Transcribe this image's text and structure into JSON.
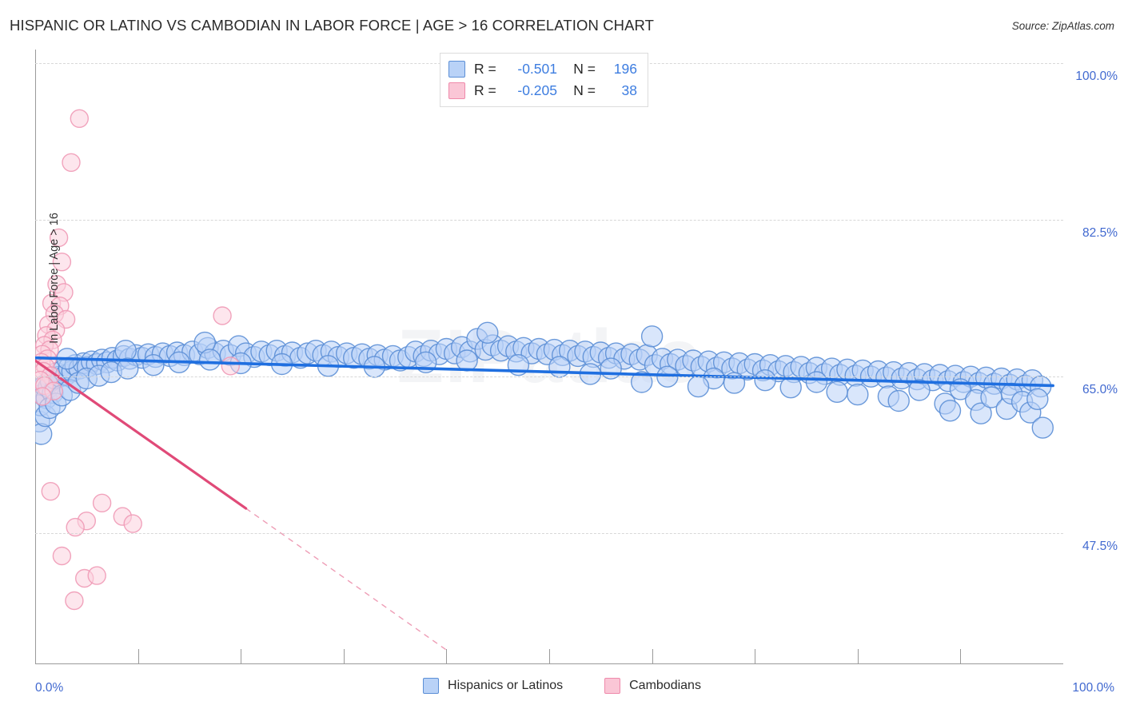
{
  "header": {
    "title": "HISPANIC OR LATINO VS CAMBODIAN IN LABOR FORCE | AGE > 16 CORRELATION CHART",
    "source": "Source: ZipAtlas.com"
  },
  "watermark": "ZIPatlas",
  "stat_legend": {
    "rows": [
      {
        "color": "#b9d2f7",
        "r_label": "R =",
        "r_value": "-0.501",
        "n_label": "N =",
        "n_value": "196"
      },
      {
        "color": "#fac6d6",
        "r_label": "R =",
        "r_value": "-0.205",
        "n_label": "N =",
        "n_value": "38"
      }
    ]
  },
  "series_legend": [
    {
      "label": "Hispanics or Latinos",
      "color": "#b9d2f7"
    },
    {
      "label": "Cambodians",
      "color": "#fac6d6"
    }
  ],
  "axes": {
    "y_title": "In Labor Force | Age > 16",
    "y_ticks": [
      "100.0%",
      "82.5%",
      "65.0%",
      "47.5%"
    ],
    "x_ticks": [
      "0.0%",
      "100.0%"
    ],
    "x_min": 0,
    "x_max": 100,
    "y_min": 33.0,
    "y_max": 101.5
  },
  "colors": {
    "blue_fill": "#b9d2f7",
    "blue_stroke": "#5c8fd6",
    "blue_line": "#1f6fe0",
    "pink_fill": "#fbd2de",
    "pink_stroke": "#f09ab6",
    "pink_line": "#e04a78",
    "tick_text": "#4169d0",
    "grid": "#d8d8d8"
  },
  "chart_data": {
    "type": "scatter",
    "title": "HISPANIC OR LATINO VS CAMBODIAN IN LABOR FORCE | AGE > 16 CORRELATION CHART",
    "xlabel": "",
    "ylabel": "In Labor Force | Age > 16",
    "xlim": [
      0,
      100
    ],
    "ylim": [
      33.0,
      101.5
    ],
    "x_tick_labels": [
      "0.0%",
      "100.0%"
    ],
    "y_tick_values": [
      100.0,
      82.5,
      65.0,
      47.5
    ],
    "y_tick_labels": [
      "100.0%",
      "82.5%",
      "65.0%",
      "47.5%"
    ],
    "grid": true,
    "legend_position": "bottom-center",
    "series": [
      {
        "name": "Hispanics or Latinos",
        "color": "#b9d2f7",
        "R": -0.501,
        "N": 196,
        "trendline": {
          "style": "solid",
          "color": "#1f6fe0",
          "x0": 0.0,
          "y0": 67.1,
          "x1": 99.0,
          "y1": 64.0
        },
        "points": [
          [
            0.4,
            60.0
          ],
          [
            0.5,
            61.8
          ],
          [
            0.7,
            63.0
          ],
          [
            0.9,
            64.0
          ],
          [
            1.1,
            62.6
          ],
          [
            1.3,
            63.8
          ],
          [
            1.5,
            64.5
          ],
          [
            1.7,
            63.2
          ],
          [
            1.9,
            64.8
          ],
          [
            2.1,
            65.4
          ],
          [
            2.4,
            65.0
          ],
          [
            2.7,
            65.7
          ],
          [
            3.0,
            65.2
          ],
          [
            3.3,
            66.0
          ],
          [
            3.6,
            65.6
          ],
          [
            3.9,
            66.3
          ],
          [
            4.3,
            65.9
          ],
          [
            4.7,
            66.5
          ],
          [
            5.1,
            66.1
          ],
          [
            5.5,
            66.7
          ],
          [
            6.0,
            66.4
          ],
          [
            6.5,
            66.9
          ],
          [
            7.0,
            66.6
          ],
          [
            7.5,
            67.1
          ],
          [
            8.0,
            66.8
          ],
          [
            8.6,
            67.3
          ],
          [
            9.2,
            67.0
          ],
          [
            9.8,
            67.4
          ],
          [
            10.4,
            67.1
          ],
          [
            11.0,
            67.5
          ],
          [
            11.7,
            67.2
          ],
          [
            12.4,
            67.6
          ],
          [
            13.1,
            67.3
          ],
          [
            13.8,
            67.7
          ],
          [
            14.5,
            67.4
          ],
          [
            15.3,
            67.8
          ],
          [
            16.0,
            67.5
          ],
          [
            16.8,
            68.2
          ],
          [
            17.5,
            67.6
          ],
          [
            18.3,
            67.9
          ],
          [
            19.0,
            67.4
          ],
          [
            19.8,
            68.4
          ],
          [
            20.5,
            67.6
          ],
          [
            21.3,
            67.2
          ],
          [
            22.0,
            67.8
          ],
          [
            22.8,
            67.4
          ],
          [
            23.5,
            67.9
          ],
          [
            24.3,
            67.3
          ],
          [
            25.0,
            67.7
          ],
          [
            25.8,
            67.1
          ],
          [
            26.5,
            67.6
          ],
          [
            27.3,
            67.9
          ],
          [
            28.0,
            67.4
          ],
          [
            28.8,
            67.8
          ],
          [
            29.5,
            67.2
          ],
          [
            30.3,
            67.6
          ],
          [
            31.0,
            67.1
          ],
          [
            31.8,
            67.5
          ],
          [
            32.5,
            67.0
          ],
          [
            33.3,
            67.4
          ],
          [
            34.0,
            66.9
          ],
          [
            34.8,
            67.3
          ],
          [
            35.5,
            66.8
          ],
          [
            36.3,
            67.2
          ],
          [
            37.0,
            67.8
          ],
          [
            37.8,
            67.3
          ],
          [
            38.5,
            67.9
          ],
          [
            39.3,
            67.5
          ],
          [
            40.0,
            68.1
          ],
          [
            40.8,
            67.6
          ],
          [
            41.5,
            68.3
          ],
          [
            42.3,
            67.8
          ],
          [
            43.0,
            69.2
          ],
          [
            43.8,
            68.0
          ],
          [
            44.5,
            68.5
          ],
          [
            45.3,
            67.9
          ],
          [
            46.0,
            68.4
          ],
          [
            46.8,
            67.8
          ],
          [
            47.5,
            68.2
          ],
          [
            48.3,
            67.6
          ],
          [
            49.0,
            68.1
          ],
          [
            49.8,
            67.5
          ],
          [
            50.5,
            68.0
          ],
          [
            51.3,
            67.4
          ],
          [
            52.0,
            67.9
          ],
          [
            52.8,
            67.3
          ],
          [
            53.5,
            67.8
          ],
          [
            54.3,
            67.2
          ],
          [
            55.0,
            67.7
          ],
          [
            55.8,
            67.1
          ],
          [
            56.5,
            67.6
          ],
          [
            57.3,
            67.0
          ],
          [
            58.0,
            67.5
          ],
          [
            58.8,
            66.9
          ],
          [
            59.5,
            67.4
          ],
          [
            60.3,
            66.3
          ],
          [
            61.0,
            67.0
          ],
          [
            61.8,
            66.4
          ],
          [
            62.5,
            66.9
          ],
          [
            63.3,
            66.2
          ],
          [
            64.0,
            66.8
          ],
          [
            64.8,
            66.1
          ],
          [
            65.5,
            66.7
          ],
          [
            66.3,
            66.0
          ],
          [
            67.0,
            66.6
          ],
          [
            67.8,
            65.9
          ],
          [
            68.5,
            66.5
          ],
          [
            69.3,
            65.8
          ],
          [
            70.0,
            66.4
          ],
          [
            70.8,
            65.7
          ],
          [
            71.5,
            66.3
          ],
          [
            72.3,
            65.6
          ],
          [
            73.0,
            66.2
          ],
          [
            73.8,
            65.5
          ],
          [
            74.5,
            66.1
          ],
          [
            75.3,
            65.4
          ],
          [
            76.0,
            66.0
          ],
          [
            76.8,
            65.3
          ],
          [
            77.5,
            65.9
          ],
          [
            78.3,
            65.2
          ],
          [
            79.0,
            65.8
          ],
          [
            79.8,
            65.1
          ],
          [
            80.5,
            65.7
          ],
          [
            81.3,
            65.0
          ],
          [
            82.0,
            65.6
          ],
          [
            82.8,
            64.9
          ],
          [
            83.5,
            65.5
          ],
          [
            84.3,
            64.8
          ],
          [
            85.0,
            65.4
          ],
          [
            85.8,
            64.7
          ],
          [
            86.5,
            65.3
          ],
          [
            87.3,
            64.6
          ],
          [
            88.0,
            65.2
          ],
          [
            88.8,
            64.5
          ],
          [
            89.5,
            65.1
          ],
          [
            90.3,
            64.4
          ],
          [
            91.0,
            65.0
          ],
          [
            91.8,
            64.3
          ],
          [
            92.5,
            64.9
          ],
          [
            93.3,
            64.2
          ],
          [
            94.0,
            64.8
          ],
          [
            94.8,
            64.1
          ],
          [
            95.5,
            64.7
          ],
          [
            96.3,
            64.0
          ],
          [
            97.0,
            64.6
          ],
          [
            97.8,
            63.9
          ],
          [
            60.0,
            69.5
          ],
          [
            44.0,
            69.9
          ],
          [
            16.5,
            68.8
          ],
          [
            8.8,
            67.9
          ],
          [
            3.1,
            67.0
          ],
          [
            0.6,
            58.6
          ],
          [
            1.0,
            60.6
          ],
          [
            1.4,
            61.5
          ],
          [
            2.0,
            62.0
          ],
          [
            2.6,
            62.9
          ],
          [
            3.4,
            63.5
          ],
          [
            4.2,
            64.3
          ],
          [
            5.0,
            64.8
          ],
          [
            6.2,
            65.1
          ],
          [
            7.4,
            65.5
          ],
          [
            9.0,
            65.9
          ],
          [
            11.5,
            66.3
          ],
          [
            14.0,
            66.6
          ],
          [
            17.0,
            66.9
          ],
          [
            20.0,
            66.5
          ],
          [
            24.0,
            66.4
          ],
          [
            28.5,
            66.2
          ],
          [
            33.0,
            66.1
          ],
          [
            38.0,
            66.6
          ],
          [
            42.0,
            66.8
          ],
          [
            47.0,
            66.3
          ],
          [
            51.0,
            66.1
          ],
          [
            56.0,
            65.9
          ],
          [
            61.5,
            65.0
          ],
          [
            66.0,
            64.8
          ],
          [
            71.0,
            64.6
          ],
          [
            76.0,
            64.4
          ],
          [
            80.0,
            63.0
          ],
          [
            83.0,
            62.8
          ],
          [
            86.0,
            63.5
          ],
          [
            88.5,
            62.0
          ],
          [
            90.0,
            63.6
          ],
          [
            91.5,
            62.4
          ],
          [
            92.0,
            60.9
          ],
          [
            93.0,
            62.7
          ],
          [
            94.5,
            61.4
          ],
          [
            95.0,
            63.1
          ],
          [
            96.0,
            62.2
          ],
          [
            96.8,
            61.0
          ],
          [
            97.5,
            62.5
          ],
          [
            98.0,
            59.3
          ],
          [
            89.0,
            61.2
          ],
          [
            84.0,
            62.3
          ],
          [
            78.0,
            63.3
          ],
          [
            73.5,
            63.8
          ],
          [
            68.0,
            64.3
          ],
          [
            64.5,
            63.9
          ],
          [
            59.0,
            64.4
          ],
          [
            54.0,
            65.3
          ]
        ]
      },
      {
        "name": "Cambodians",
        "color": "#fac6d6",
        "R": -0.205,
        "N": 38,
        "trendline": {
          "style": "solid-then-dashed",
          "color": "#e04a78",
          "x0": 0.0,
          "y0": 66.8,
          "x_break": 20.5,
          "y_break": 50.3,
          "x1": 40.0,
          "y1": 34.5
        },
        "points": [
          [
            4.3,
            93.8
          ],
          [
            3.5,
            88.9
          ],
          [
            2.3,
            80.5
          ],
          [
            2.6,
            77.8
          ],
          [
            2.1,
            75.3
          ],
          [
            2.8,
            74.4
          ],
          [
            1.6,
            73.2
          ],
          [
            2.4,
            72.9
          ],
          [
            1.9,
            72.0
          ],
          [
            3.0,
            71.4
          ],
          [
            1.3,
            70.8
          ],
          [
            2.0,
            70.2
          ],
          [
            1.1,
            69.6
          ],
          [
            1.7,
            69.1
          ],
          [
            0.9,
            68.5
          ],
          [
            1.4,
            68.0
          ],
          [
            0.7,
            67.5
          ],
          [
            1.2,
            67.0
          ],
          [
            0.6,
            66.6
          ],
          [
            1.0,
            66.1
          ],
          [
            0.8,
            65.6
          ],
          [
            1.5,
            65.1
          ],
          [
            0.5,
            64.6
          ],
          [
            0.9,
            64.0
          ],
          [
            1.8,
            63.4
          ],
          [
            0.7,
            62.8
          ],
          [
            18.2,
            71.8
          ],
          [
            19.0,
            66.2
          ],
          [
            1.5,
            52.2
          ],
          [
            6.5,
            50.9
          ],
          [
            8.5,
            49.4
          ],
          [
            5.0,
            48.9
          ],
          [
            9.5,
            48.6
          ],
          [
            3.9,
            48.2
          ],
          [
            2.6,
            45.0
          ],
          [
            4.8,
            42.5
          ],
          [
            6.0,
            42.8
          ],
          [
            3.8,
            40.0
          ]
        ]
      }
    ]
  }
}
